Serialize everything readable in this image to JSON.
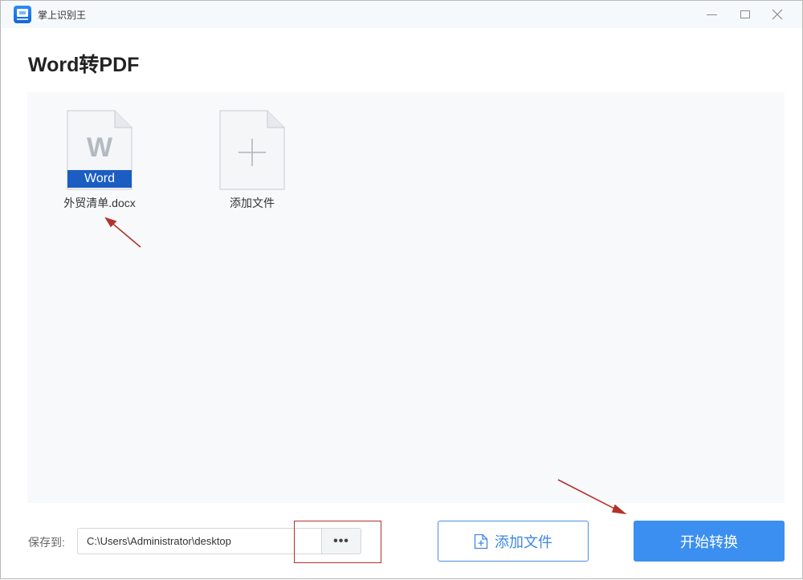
{
  "window": {
    "app_title": "掌上识别王"
  },
  "page": {
    "title": "Word转PDF"
  },
  "files": [
    {
      "name": "外贸清单.docx",
      "type_label": "Word",
      "type_letter": "W"
    }
  ],
  "add_card": {
    "label": "添加文件"
  },
  "footer": {
    "save_label": "保存到:",
    "save_path": "C:\\Users\\Administrator\\desktop",
    "browse_label": "•••",
    "add_file_label": "添加文件",
    "start_label": "开始转换"
  },
  "colors": {
    "accent": "#3b8ff0",
    "word_blue": "#1c5dc2",
    "annotation_red": "#b3322a"
  }
}
